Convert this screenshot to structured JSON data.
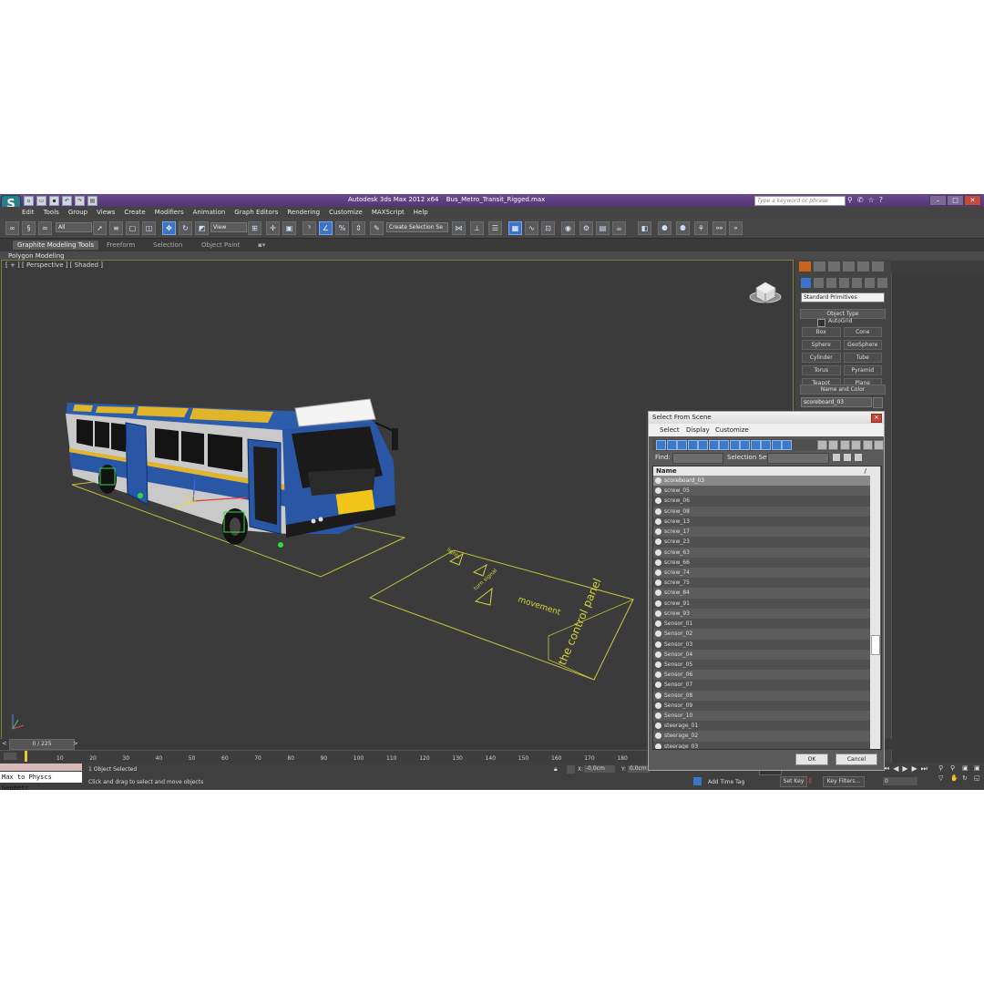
{
  "app": {
    "title": "Autodesk 3ds Max  2012 x64",
    "file": "Bus_Metro_Transit_Rigged.max",
    "search_placeholder": "Type a keyword or phrase"
  },
  "menu": [
    "Edit",
    "Tools",
    "Group",
    "Views",
    "Create",
    "Modifiers",
    "Animation",
    "Graph Editors",
    "Rendering",
    "Customize",
    "MAXScript",
    "Help"
  ],
  "toolbar": {
    "selection_filter": "All",
    "ref_coord": "View",
    "named_selection": "Create Selection Se"
  },
  "ribbon": {
    "tabs": [
      "Graphite Modeling Tools",
      "Freeform",
      "Selection",
      "Object Paint"
    ],
    "sub_label": "Polygon Modeling"
  },
  "viewport": {
    "label": "[ + ] [ Perspective ] [ Shaded ]",
    "decal_lines": [
      "the control panel",
      "movement",
      "lights",
      "turn signal"
    ]
  },
  "command_panel": {
    "category_dropdown": "Standard Primitives",
    "object_type_title": "Object Type",
    "autogrid_label": "AutoGrid",
    "primitives": [
      "Box",
      "Cone",
      "Sphere",
      "GeoSphere",
      "Cylinder",
      "Tube",
      "Torus",
      "Pyramid",
      "Teapot",
      "Plane"
    ],
    "name_color_title": "Name and Color",
    "object_name": "scoreboard_03"
  },
  "dialog": {
    "title": "Select From Scene",
    "menu": [
      "Select",
      "Display",
      "Customize"
    ],
    "find_label": "Find:",
    "selection_set_label": "Selection Set:",
    "column_name": "Name",
    "sort_marker": "/",
    "ok_label": "OK",
    "cancel_label": "Cancel",
    "items": [
      "scoreboard_03",
      "screw_05",
      "screw_06",
      "screw_08",
      "screw_13",
      "screw_17",
      "screw_23",
      "screw_63",
      "screw_66",
      "screw_74",
      "screw_75",
      "screw_84",
      "screw_91",
      "screw_93",
      "Sensor_01",
      "Sensor_02",
      "Sensor_03",
      "Sensor_04",
      "Sensor_05",
      "Sensor_06",
      "Sensor_07",
      "Sensor_08",
      "Sensor_09",
      "Sensor_10",
      "steerage_01",
      "steerage_02",
      "steerage_03"
    ],
    "selected_index": 0
  },
  "timeline": {
    "frame_counter": "0 / 225",
    "ticks": [
      "10",
      "20",
      "30",
      "40",
      "50",
      "60",
      "70",
      "80",
      "90",
      "100",
      "110",
      "120",
      "130",
      "140",
      "150",
      "160",
      "170",
      "180"
    ]
  },
  "status": {
    "maxscript_text": "Max to Physcs Geometr",
    "selection_text": "1 Object Selected",
    "prompt_text": "Click and drag to select and move objects",
    "x_label": "X:",
    "x_value": "-0,0cm",
    "y_label": "Y:",
    "y_value": "0,0cm",
    "add_time_tag": "Add Time Tag",
    "set_key": "Set Key",
    "key_filters": "Key Filters...",
    "frame_value": "0"
  }
}
